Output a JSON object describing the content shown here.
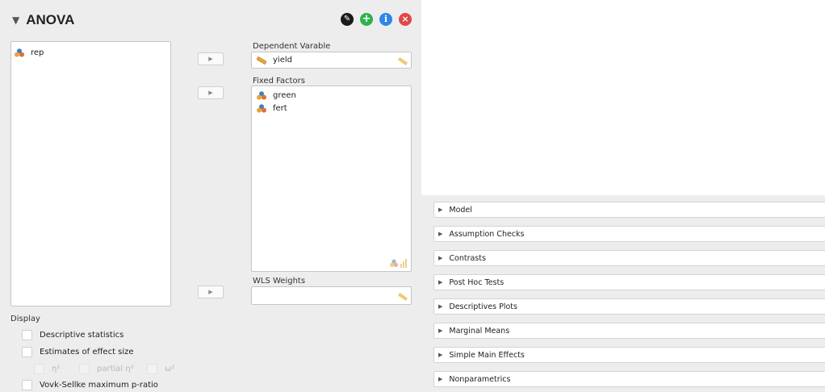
{
  "header": {
    "title": "ANOVA",
    "collapse_glyph": "▼",
    "buttons": [
      {
        "name": "edit-icon",
        "glyph": "✎",
        "color": "#1a1a1a"
      },
      {
        "name": "add-icon",
        "glyph": "+",
        "color": "#2db34a"
      },
      {
        "name": "info-icon",
        "glyph": "i",
        "color": "#2f86e6"
      },
      {
        "name": "close-icon",
        "glyph": "×",
        "color": "#e04848"
      }
    ]
  },
  "source_vars": [
    {
      "name": "rep",
      "icon": "nominal-variable-icon"
    }
  ],
  "move_glyph": "▶",
  "dependent": {
    "label": "Dependent Varable",
    "value": "yield",
    "icon": "continuous-variable-icon",
    "hint_icon": "ruler-icon"
  },
  "fixed_factors": {
    "label": "Fixed Factors",
    "items": [
      {
        "name": "green",
        "icon": "nominal-variable-icon"
      },
      {
        "name": "fert",
        "icon": "nominal-variable-icon"
      }
    ],
    "hint_icon": "nominal-ordinal-hint-icon"
  },
  "wls_weights": {
    "label": "WLS Weights",
    "value": "",
    "hint_icon": "ruler-icon"
  },
  "display": {
    "label": "Display",
    "descriptive_statistics": {
      "label": "Descriptive statistics",
      "checked": false
    },
    "effect_size": {
      "label": "Estimates of effect size",
      "checked": false
    },
    "effect_options": [
      {
        "label": "η²",
        "checked": false,
        "enabled": false
      },
      {
        "label": "partial η²",
        "checked": false,
        "enabled": false
      },
      {
        "label": "ω²",
        "checked": false,
        "enabled": false
      }
    ],
    "vovk_sellke": {
      "label": "Vovk-Sellke maximum p-ratio",
      "checked": false
    }
  },
  "sections": [
    {
      "label": "Model",
      "expanded": false
    },
    {
      "label": "Assumption Checks",
      "expanded": false
    },
    {
      "label": "Contrasts",
      "expanded": false
    },
    {
      "label": "Post Hoc Tests",
      "expanded": false
    },
    {
      "label": "Descriptives Plots",
      "expanded": false
    },
    {
      "label": "Marginal Means",
      "expanded": false
    },
    {
      "label": "Simple Main Effects",
      "expanded": false
    },
    {
      "label": "Nonparametrics",
      "expanded": false
    }
  ],
  "section_arrow": "▶"
}
